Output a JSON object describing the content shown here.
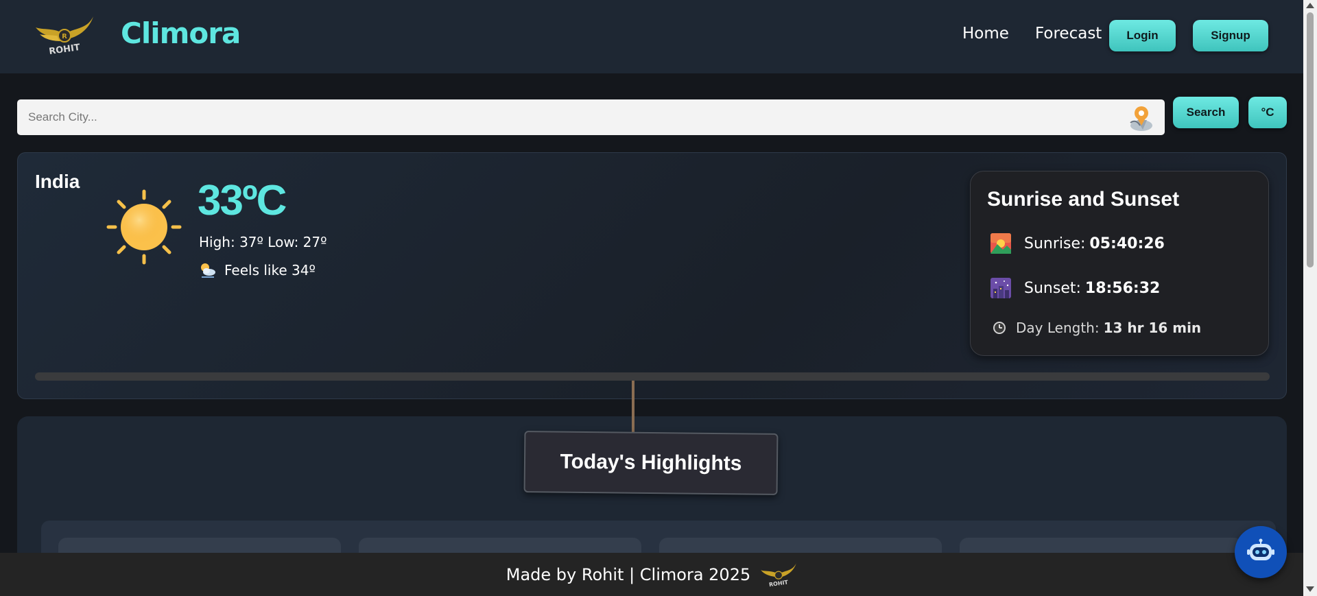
{
  "header": {
    "logo_text": "ROHIT",
    "brand": "Climora",
    "nav": [
      "Home",
      "Forecast"
    ],
    "login_label": "Login",
    "signup_label": "Signup"
  },
  "search": {
    "placeholder": "Search City...",
    "search_label": "Search",
    "unit_label": "°C"
  },
  "weather": {
    "location": "India",
    "icon": "sun-icon",
    "temperature": "33ºC",
    "high_low": "High: 37º Low: 27º",
    "feels_like": "Feels like 34º"
  },
  "sun_card": {
    "title": "Sunrise and Sunset",
    "sunrise_label": "Sunrise:",
    "sunrise_value": "05:40:26",
    "sunset_label": "Sunset:",
    "sunset_value": "18:56:32",
    "day_length_label": "Day Length:",
    "day_length_value": "13 hr 16 min"
  },
  "highlights": {
    "title": "Today's Highlights"
  },
  "footer": {
    "text": "Made by Rohit | Climora 2025"
  },
  "colors": {
    "accent": "#5ee6e0",
    "background": "#14171c",
    "header": "#1e2733",
    "chatbot": "#1050b8"
  }
}
